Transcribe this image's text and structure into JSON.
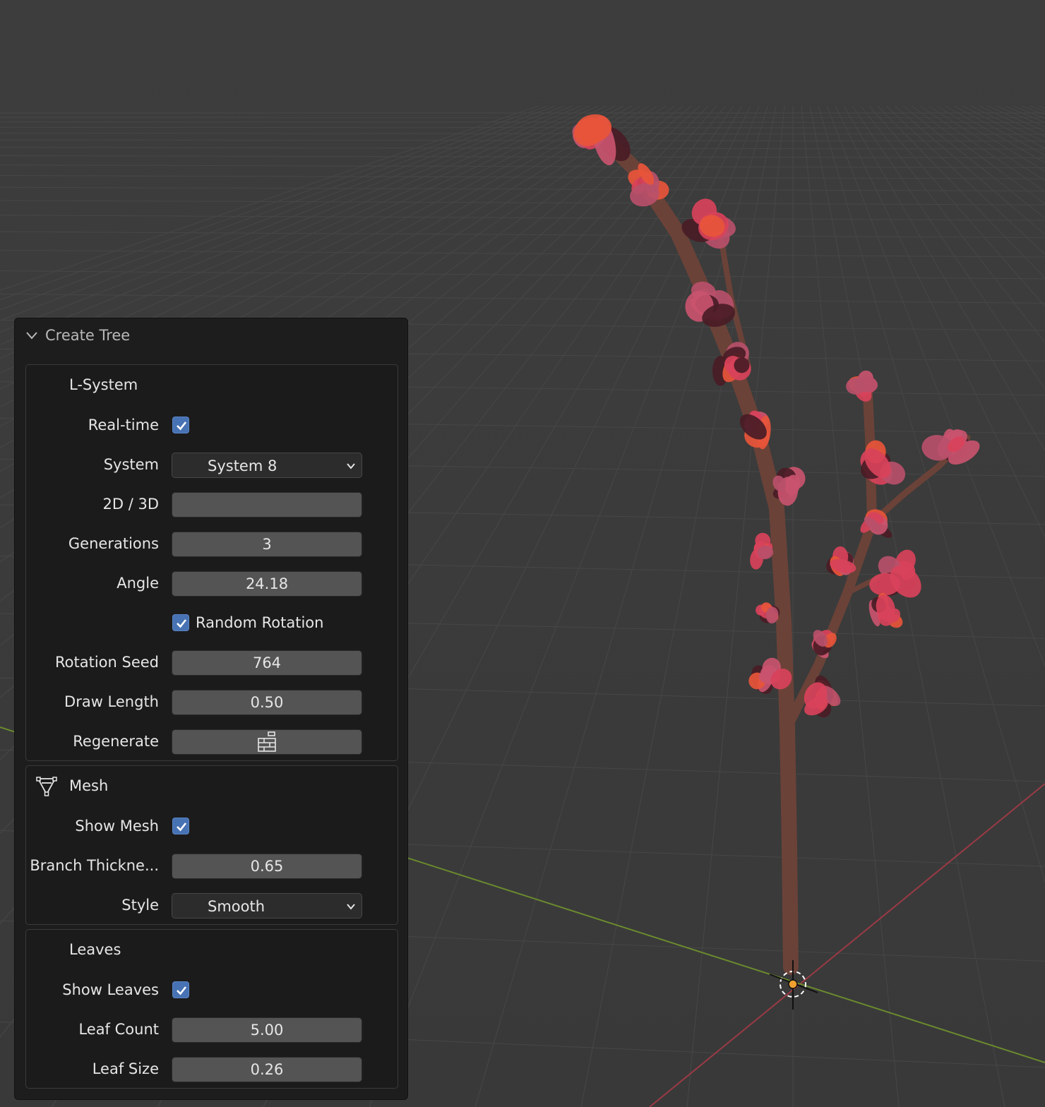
{
  "panel": {
    "title": "Create Tree",
    "lsystem": {
      "title": "L-System",
      "realtime_label": "Real-time",
      "realtime_checked": true,
      "system_label": "System",
      "system_value": "System 8",
      "dim_label": "2D / 3D",
      "generations_label": "Generations",
      "generations_value": "3",
      "angle_label": "Angle",
      "angle_value": "24.18",
      "random_rotation_label": "Random Rotation",
      "random_rotation_checked": true,
      "rotation_seed_label": "Rotation Seed",
      "rotation_seed_value": "764",
      "draw_length_label": "Draw Length",
      "draw_length_value": "0.50",
      "regenerate_label": "Regenerate",
      "regenerate_icon": "regenerate-icon"
    },
    "mesh": {
      "title": "Mesh",
      "icon": "mesh-icon",
      "show_mesh_label": "Show Mesh",
      "show_mesh_checked": true,
      "branch_thickness_label": "Branch Thickne...",
      "branch_thickness_value": "0.65",
      "style_label": "Style",
      "style_value": "Smooth"
    },
    "leaves": {
      "title": "Leaves",
      "show_leaves_label": "Show Leaves",
      "show_leaves_checked": true,
      "leaf_count_label": "Leaf Count",
      "leaf_count_value": "5.00",
      "leaf_size_label": "Leaf Size",
      "leaf_size_value": "0.26"
    }
  },
  "colors": {
    "viewport_bg": "#3a3a3a",
    "grid": "#4a4a4a",
    "x_axis": "#9b3a45",
    "y_axis": "#6a8a2e",
    "checkbox": "#4772b3",
    "trunk": "#6b4238",
    "leaf_palette": [
      "#d8425a",
      "#e8553a",
      "#c9546f",
      "#4a1c26",
      "#b8506a"
    ],
    "origin": "#f0a030"
  }
}
